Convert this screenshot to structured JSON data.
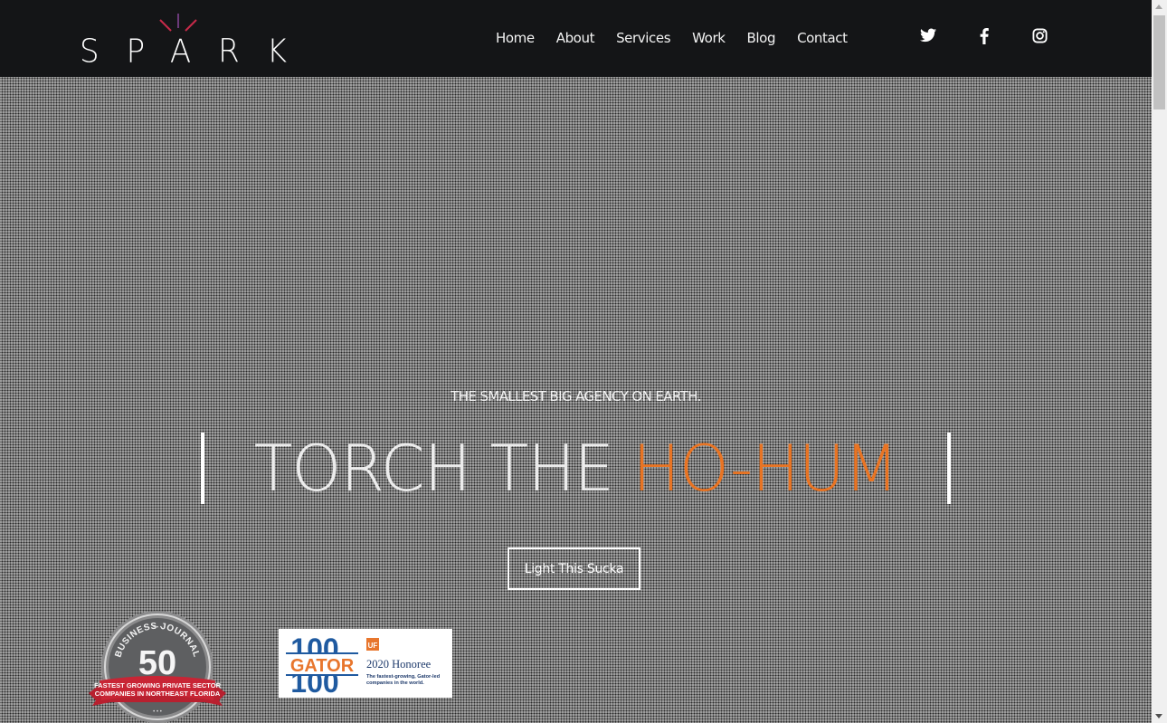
{
  "brand": {
    "logo_text": "SPARK",
    "ray_colors": [
      "#c72a4a",
      "#6b3a7a",
      "#c72a4a"
    ]
  },
  "nav": {
    "items": [
      {
        "label": "Home"
      },
      {
        "label": "About"
      },
      {
        "label": "Services"
      },
      {
        "label": "Work"
      },
      {
        "label": "Blog"
      },
      {
        "label": "Contact"
      }
    ]
  },
  "social": {
    "items": [
      {
        "icon": "twitter-icon"
      },
      {
        "icon": "facebook-icon"
      },
      {
        "icon": "instagram-icon"
      }
    ]
  },
  "hero": {
    "subtitle": "THE SMALLEST BIG AGENCY ON EARTH.",
    "title_white": "TORCH THE ",
    "title_orange": "HO-HUM",
    "accent_color": "#e97423",
    "cta_label": "Light This Sucka"
  },
  "awards": {
    "bj50": {
      "top_text": "BUSINESS JOURNAL",
      "number": "50",
      "ribbon_line1": "FASTEST GROWING PRIVATE SECTOR",
      "ribbon_line2": "COMPANIES IN NORTHEAST FLORIDA"
    },
    "gator100": {
      "number": "100",
      "word": "GATOR",
      "uf": "UF",
      "honoree": "2020 Honoree",
      "tagline1": "The fastest-growing, Gator-led",
      "tagline2": "companies in the world."
    }
  }
}
